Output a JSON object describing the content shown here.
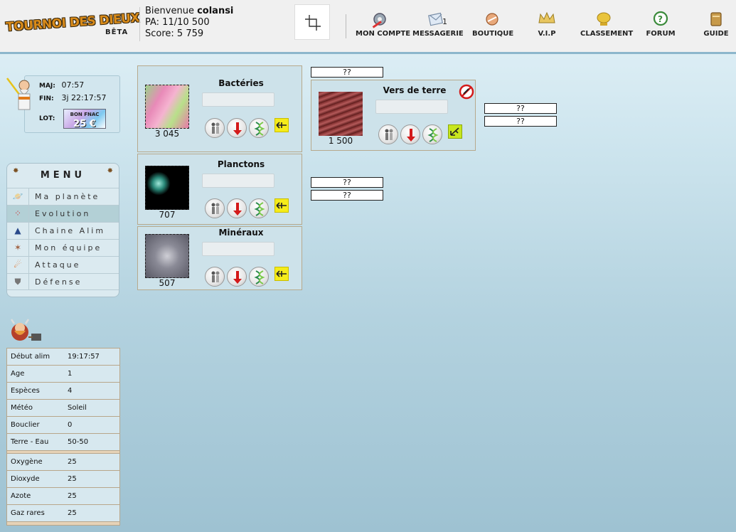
{
  "header": {
    "logo_text": "TOURNOI DES DIEUX",
    "beta": "BÊTA",
    "welcome_prefix": "Bienvenue",
    "username": "colansi",
    "pa": "PA: 11/10 500",
    "score": "Score: 5 759",
    "nav": [
      {
        "label": "MON COMPTE",
        "icon": "tools-icon"
      },
      {
        "label": "MESSAGERIE",
        "icon": "mail-icon",
        "badge": "1"
      },
      {
        "label": "BOUTIQUE",
        "icon": "shop-icon"
      },
      {
        "label": "V.I.P",
        "icon": "vip-crown-icon"
      },
      {
        "label": "CLASSEMENT",
        "icon": "trophy-icon"
      },
      {
        "label": "FORUM",
        "icon": "forum-icon"
      },
      {
        "label": "GUIDE",
        "icon": "book-icon"
      }
    ]
  },
  "timer": {
    "maj_label": "MAJ:",
    "maj_value": "07:57",
    "fin_label": "FIN:",
    "fin_value": "3j 22:17:57",
    "lot_label": "LOT:",
    "lot_top": "BON FNAC",
    "lot_value": "25 €"
  },
  "menu": {
    "title": "MENU",
    "items": [
      {
        "label": "Ma planète",
        "icon": "planet-icon",
        "active": false
      },
      {
        "label": "Evolution",
        "icon": "evolution-icon",
        "active": true
      },
      {
        "label": "Chaine Alim",
        "icon": "pyramid-icon",
        "active": false
      },
      {
        "label": "Mon équipe",
        "icon": "team-icon",
        "active": false
      },
      {
        "label": "Attaque",
        "icon": "fire-icon",
        "active": false
      },
      {
        "label": "Défense",
        "icon": "shield-icon",
        "active": false
      }
    ]
  },
  "stats": {
    "group1": [
      {
        "key": "Début alim",
        "value": "19:17:57"
      },
      {
        "key": "Age",
        "value": "1"
      },
      {
        "key": "Espèces",
        "value": "4"
      },
      {
        "key": "Météo",
        "value": "Soleil"
      },
      {
        "key": "Bouclier",
        "value": "0"
      },
      {
        "key": "Terre - Eau",
        "value": "50-50"
      }
    ],
    "group2": [
      {
        "key": "Oxygène",
        "value": "25"
      },
      {
        "key": "Dioxyde",
        "value": "25"
      },
      {
        "key": "Azote",
        "value": "25"
      },
      {
        "key": "Gaz rares",
        "value": "25"
      }
    ]
  },
  "species": [
    {
      "name": "Bactéries",
      "count": "3 045"
    },
    {
      "name": "Planctons",
      "count": "707"
    },
    {
      "name": "Minéraux",
      "count": "507"
    },
    {
      "name": "Vers de terre",
      "count": "1 500"
    }
  ],
  "unknown_label": "??",
  "colors": {
    "accent_yellow": "#f5ec1a",
    "accent_green": "#c8e61e",
    "card_bg": "#cde2ea",
    "menu_active": "#b3d0d6"
  }
}
